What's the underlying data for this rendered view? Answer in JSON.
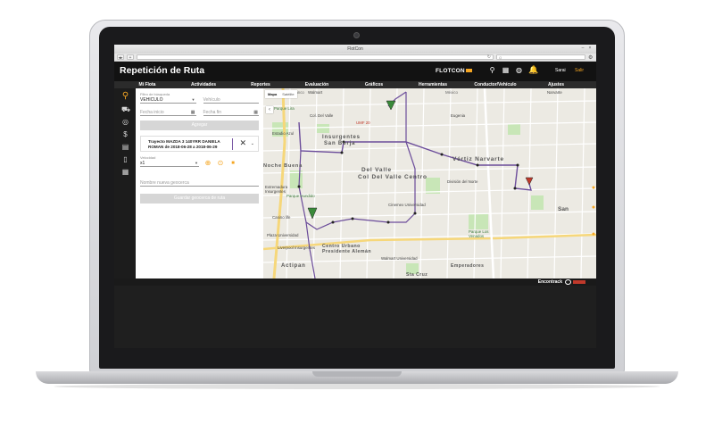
{
  "browser": {
    "window_title": "FlotCon"
  },
  "app": {
    "title": "Repetición de Ruta",
    "brand": "FLOTCON",
    "user": "Sarai",
    "logout": "Salir"
  },
  "nav": [
    "Mi Flota",
    "Actividades",
    "Reportes",
    "Evaluación",
    "Gráficos",
    "Herramientas",
    "Conductor/Vehículo",
    "Ajustes"
  ],
  "form": {
    "search_filter_label": "Filtro de búsqueda",
    "search_filter_value": "VEHICULO",
    "vehicle_placeholder": "Vehículo",
    "start_date_placeholder": "Fecha inicio",
    "end_date_placeholder": "Fecha fin",
    "add_button": "Agregar",
    "trip_line1": "Trayecto MAZDA 3 140YRR DANIELA",
    "trip_line2": "ROMAN de 2018-06-28 a 2018-06-29",
    "speed_label": "Velocidad",
    "speed_value": "x1",
    "geofence_placeholder": "Nombre nueva geocerca",
    "save_geofence_button": "Guardar geocerca de ruta"
  },
  "map": {
    "tab_map": "Mapa",
    "tab_satellite": "Satélite",
    "labels": [
      "Polanco",
      "México",
      "Parque Lira",
      "Del Valle",
      "San Borja",
      "Insurgentes",
      "Col. Del Valle",
      "Col Del Valle Centro",
      "Estadio Azul",
      "Noche Buena",
      "Extremadura Insurgentes",
      "Parque Hundido",
      "Narvarte",
      "Vértiz Narvarte",
      "División del Norte",
      "Cinemex Universidad",
      "Eugenia",
      "UMF 20",
      "San",
      "Casino life",
      "Plaza Universidad",
      "Centro Urbano Presidente Alemán",
      "Parque Los Venados",
      "Actipan",
      "Emperadores",
      "Sta Cruz",
      "Walmart Universidad",
      "Liverpool Insurgentes",
      "Walmart"
    ]
  },
  "footer": {
    "brand": "Encontrack"
  },
  "colors": {
    "accent": "#f5a623",
    "route": "#6b4c9a",
    "header_bg": "#121212"
  }
}
